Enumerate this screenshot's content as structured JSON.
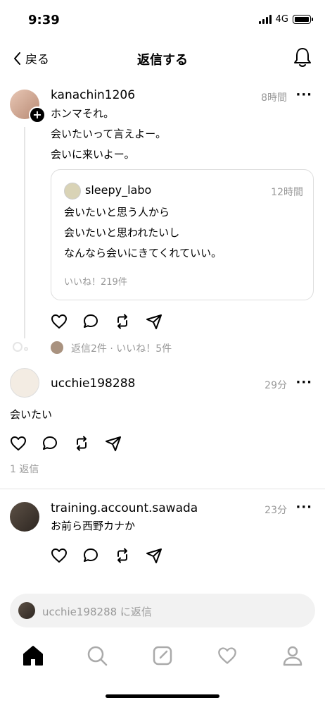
{
  "status_bar": {
    "time": "9:39",
    "network": "4G"
  },
  "nav": {
    "back_label": "戻る",
    "title": "返信する"
  },
  "main_post": {
    "username": "kanachin1206",
    "time": "8時間",
    "lines": [
      "ホンマそれ。",
      "会いたいって言えよー。",
      "会いに来いよー。"
    ],
    "quote": {
      "username": "sleepy_labo",
      "time": "12時間",
      "lines": [
        "会いたいと思う人から",
        "会いたいと思われたいし",
        "なんなら会いにきてくれていい。"
      ],
      "likes": "いいね！219件"
    },
    "meta": "返信2件 · いいね！5件"
  },
  "reply1": {
    "username": "ucchie198288",
    "time": "29分",
    "text": "会いたい",
    "meta": "1 返信"
  },
  "reply2": {
    "username": "training.account.sawada",
    "time": "23分",
    "text": "お前ら西野カナか"
  },
  "reply_bar": {
    "placeholder": "ucchie198288 に返信"
  },
  "tabs": [
    "home-icon",
    "search-icon",
    "compose-icon",
    "heart-icon",
    "profile-icon"
  ],
  "colors": {
    "muted": "#999999",
    "divider": "#e5e5e5",
    "reply_bar_bg": "#f2f2f2"
  }
}
